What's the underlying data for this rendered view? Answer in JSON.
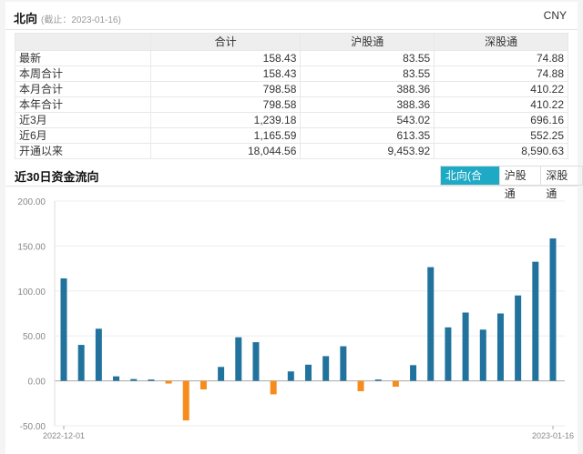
{
  "header": {
    "title": "北向",
    "date": "(截止：2023-01-16)",
    "currency": "CNY"
  },
  "table": {
    "columns": [
      "",
      "合计",
      "沪股通",
      "深股通"
    ],
    "rows": [
      [
        "最新",
        "158.43",
        "83.55",
        "74.88"
      ],
      [
        "本周合计",
        "158.43",
        "83.55",
        "74.88"
      ],
      [
        "本月合计",
        "798.58",
        "388.36",
        "410.22"
      ],
      [
        "本年合计",
        "798.58",
        "388.36",
        "410.22"
      ],
      [
        "近3月",
        "1,239.18",
        "543.02",
        "696.16"
      ],
      [
        "近6月",
        "1,165.59",
        "613.35",
        "552.25"
      ],
      [
        "开通以来",
        "18,044.56",
        "9,453.92",
        "8,590.63"
      ]
    ]
  },
  "section": {
    "title": "近30日资金流向",
    "tabs": [
      "北向(合计)",
      "沪股通",
      "深股通"
    ],
    "active_tab": 0
  },
  "chart_data": {
    "type": "bar",
    "ylim": [
      -50,
      200
    ],
    "yticks": [
      "200.00",
      "150.00",
      "100.00",
      "50.00",
      "0.00",
      "-50.00"
    ],
    "x_labels": [
      "2022-12-01",
      "2023-01-16"
    ],
    "colors": {
      "positive": "#21739e",
      "negative": "#f78c1e"
    },
    "values": [
      114,
      40,
      58,
      5,
      2,
      1.5,
      -3,
      -44,
      -9.5,
      15.5,
      48.5,
      43,
      -15,
      10.5,
      18,
      27.5,
      38.5,
      -11.5,
      1.5,
      -6.5,
      17.5,
      126.5,
      59.5,
      76,
      57,
      75,
      95,
      132.5,
      158.43
    ]
  }
}
